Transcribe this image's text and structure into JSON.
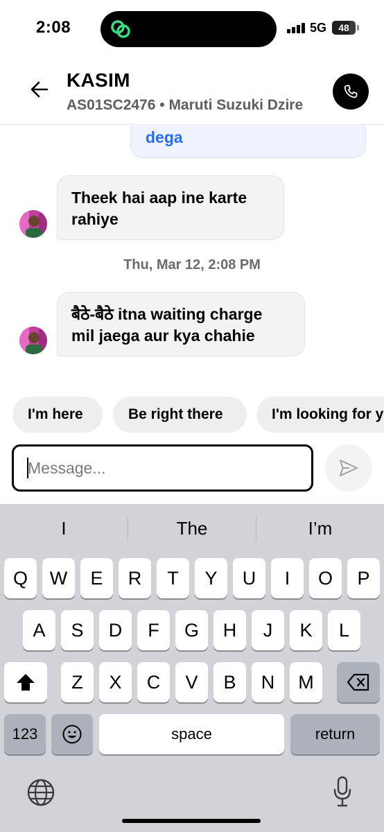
{
  "status_bar": {
    "time": "2:08",
    "network": "5G",
    "battery": "48"
  },
  "header": {
    "driver_name": "KASIM",
    "vehicle_info": "AS01SC2476 • Maruti Suzuki Dzire"
  },
  "chat": {
    "sent_partial_text": "dega",
    "messages": [
      {
        "text_line1": "Theek hai aap ine karte",
        "text_line2": "rahiye"
      },
      {
        "text_line1": "बैठे-बैठे itna waiting charge",
        "text_line2": "mil jaega aur kya chahie"
      }
    ],
    "timestamp": "Thu, Mar 12, 2:08 PM"
  },
  "quick_replies": [
    "I'm here",
    "Be right there",
    "I'm looking for y"
  ],
  "composer": {
    "placeholder": "Message...",
    "value": ""
  },
  "keyboard": {
    "suggestions": [
      "I",
      "The",
      "I’m"
    ],
    "row1": [
      "Q",
      "W",
      "E",
      "R",
      "T",
      "Y",
      "U",
      "I",
      "O",
      "P"
    ],
    "row2": [
      "A",
      "S",
      "D",
      "F",
      "G",
      "H",
      "J",
      "K",
      "L"
    ],
    "row3": [
      "Z",
      "X",
      "C",
      "V",
      "B",
      "N",
      "M"
    ],
    "numbers_key": "123",
    "space_key": "space",
    "return_key": "return"
  },
  "colors": {
    "accent_blue": "#276ef1",
    "keyboard_bg": "#d1d3d9",
    "bubble_bg": "#f3f3f3"
  }
}
